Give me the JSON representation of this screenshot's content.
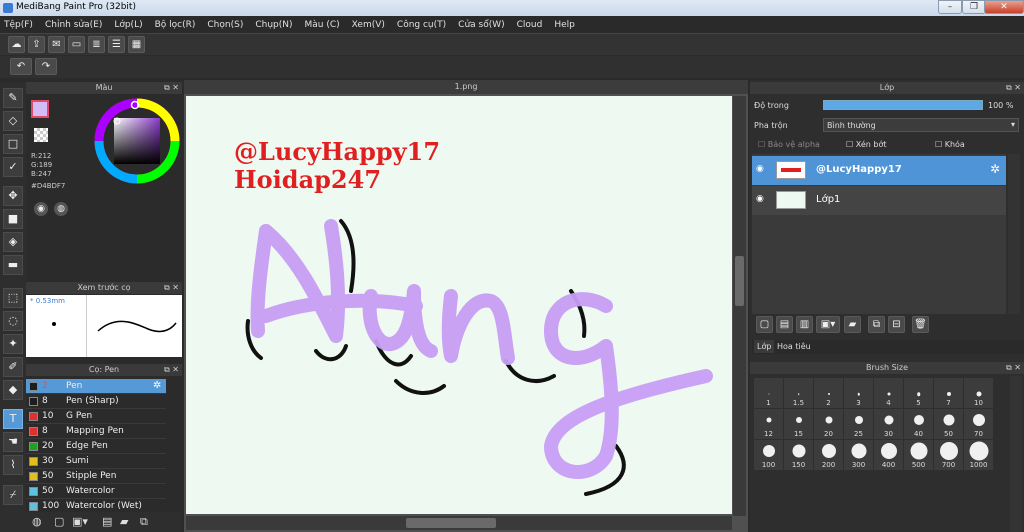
{
  "window": {
    "title": "MediBang Paint Pro (32bit)"
  },
  "menu": [
    "Tệp(F)",
    "Chỉnh sửa(E)",
    "Lớp(L)",
    "Bộ lọc(R)",
    "Chọn(S)",
    "Chụp(N)",
    "Màu (C)",
    "Xem(V)",
    "Công cụ(T)",
    "Cửa sổ(W)",
    "Cloud",
    "Help"
  ],
  "color_panel": {
    "title": "Màu",
    "r": "R:212",
    "g": "G:189",
    "b": "B:247",
    "hex": "#D4BDF7",
    "fg": "#d4bdf7"
  },
  "preview_panel": {
    "title": "Xem trước cọ",
    "size": "0.53mm"
  },
  "brush_panel": {
    "title": "Cọ: Pen",
    "brushes": [
      {
        "size": "2",
        "name": "Pen",
        "color": "#1e1e1e"
      },
      {
        "size": "8",
        "name": "Pen (Sharp)",
        "color": "#1e1e1e"
      },
      {
        "size": "10",
        "name": "G Pen",
        "color": "#e03030"
      },
      {
        "size": "8",
        "name": "Mapping Pen",
        "color": "#e03030"
      },
      {
        "size": "20",
        "name": "Edge Pen",
        "color": "#20a020"
      },
      {
        "size": "30",
        "name": "Sumi",
        "color": "#e0c020"
      },
      {
        "size": "50",
        "name": "Stipple Pen",
        "color": "#e0c020"
      },
      {
        "size": "50",
        "name": "Watercolor",
        "color": "#60c0e0"
      },
      {
        "size": "100",
        "name": "Watercolor (Wet)",
        "color": "#60c0e0"
      }
    ]
  },
  "canvas": {
    "tab": "1.png",
    "line1": "@LucyHappy17",
    "line2": "Hoidap247",
    "word": "Nung"
  },
  "layers_panel": {
    "title": "Lớp",
    "opacity_label": "Độ trong",
    "opacity_value": "100 %",
    "blend_label": "Pha trộn",
    "blend_value": "Bình thường",
    "protect_alpha": "Bảo vệ alpha",
    "clipping": "Xén bớt",
    "lock": "Khóa",
    "layers": [
      {
        "name": "@LucyHappy17"
      },
      {
        "name": "Lớp1"
      }
    ],
    "tabs": [
      "Lớp",
      "Hoa tiêu"
    ]
  },
  "brush_size": {
    "title": "Brush Size",
    "sizes": [
      "1",
      "1.5",
      "2",
      "3",
      "4",
      "5",
      "7",
      "10",
      "12",
      "15",
      "20",
      "25",
      "30",
      "40",
      "50",
      "70",
      "100",
      "150",
      "200",
      "300",
      "400",
      "500",
      "700",
      "1000"
    ]
  }
}
